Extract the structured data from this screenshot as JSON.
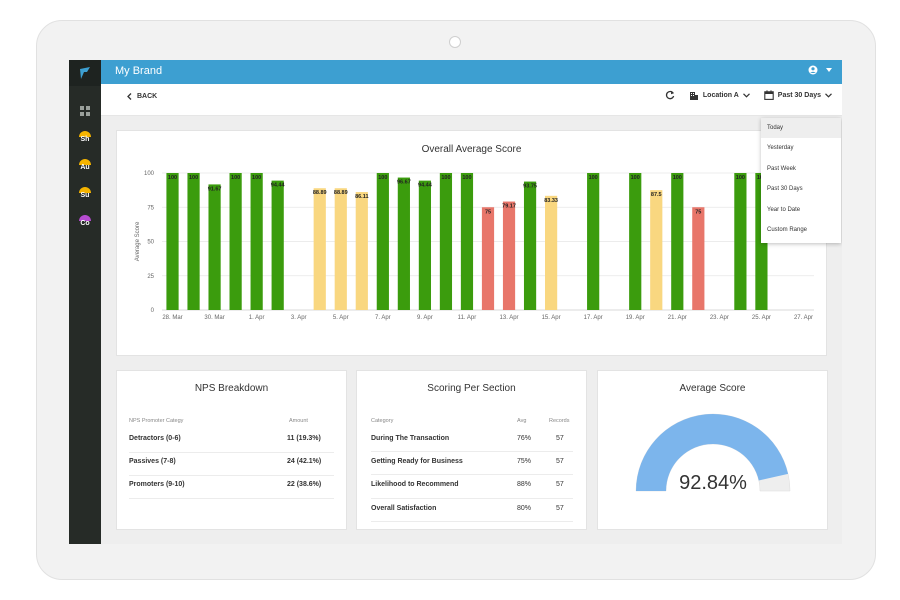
{
  "app": {
    "title": "My Brand",
    "user_icon": "account-circle-icon",
    "user_menu_icon": "caret-down-icon"
  },
  "sidebar": {
    "items": [
      {
        "label": "Sh",
        "color": "#f5b400"
      },
      {
        "label": "Au",
        "color": "#f5b400"
      },
      {
        "label": "Su",
        "color": "#f5b400"
      },
      {
        "label": "Co",
        "color": "#b54bd0"
      }
    ]
  },
  "toolbar": {
    "back_label": "BACK",
    "location_label": "Location A",
    "date_range_label": "Past 30 Days"
  },
  "date_menu": {
    "options": [
      "Today",
      "Yesterday",
      "Past Week",
      "Past 30 Days",
      "Year to Date",
      "Custom Range"
    ],
    "highlighted": "Today"
  },
  "chart_data": {
    "type": "bar",
    "title": "Overall Average Score",
    "ylabel": "Average Score",
    "xlabel": "",
    "ylim": [
      0,
      100
    ],
    "yticks": [
      0,
      25,
      50,
      75,
      100
    ],
    "grid": true,
    "x_tick_labels": [
      "28. Mar",
      "30. Mar",
      "1. Apr",
      "3. Apr",
      "5. Apr",
      "7. Apr",
      "9. Apr",
      "11. Apr",
      "13. Apr",
      "15. Apr",
      "17. Apr",
      "19. Apr",
      "21. Apr",
      "23. Apr",
      "25. Apr",
      "27. Apr"
    ],
    "bars": [
      {
        "value": 100,
        "label": "100",
        "color": "#3b9c0d"
      },
      {
        "value": 100,
        "label": "100",
        "color": "#3b9c0d"
      },
      {
        "value": 91.67,
        "label": "91.67",
        "color": "#3b9c0d"
      },
      {
        "value": 100,
        "label": "100",
        "color": "#3b9c0d"
      },
      {
        "value": 100,
        "label": "100",
        "color": "#3b9c0d"
      },
      {
        "value": 94.44,
        "label": "94.44",
        "color": "#3b9c0d"
      },
      null,
      {
        "value": 88.89,
        "label": "88.89",
        "color": "#f9d780"
      },
      {
        "value": 88.89,
        "label": "88.89",
        "color": "#f9d780"
      },
      {
        "value": 86.11,
        "label": "86.11",
        "color": "#f9d780"
      },
      {
        "value": 100,
        "label": "100",
        "color": "#3b9c0d"
      },
      {
        "value": 96.67,
        "label": "96.67",
        "color": "#3b9c0d"
      },
      {
        "value": 94.44,
        "label": "94.44",
        "color": "#3b9c0d"
      },
      {
        "value": 100,
        "label": "100",
        "color": "#3b9c0d"
      },
      {
        "value": 100,
        "label": "100",
        "color": "#3b9c0d"
      },
      {
        "value": 75,
        "label": "75",
        "color": "#e8766a"
      },
      {
        "value": 79.17,
        "label": "79.17",
        "color": "#e8766a"
      },
      {
        "value": 93.75,
        "label": "93.75",
        "color": "#3b9c0d"
      },
      {
        "value": 83.33,
        "label": "83.33",
        "color": "#f9d780"
      },
      null,
      {
        "value": 100,
        "label": "100",
        "color": "#3b9c0d"
      },
      null,
      {
        "value": 100,
        "label": "100",
        "color": "#3b9c0d"
      },
      {
        "value": 87.5,
        "label": "87.5",
        "color": "#f9d780"
      },
      {
        "value": 100,
        "label": "100",
        "color": "#3b9c0d"
      },
      {
        "value": 75,
        "label": "75",
        "color": "#e8766a"
      },
      null,
      {
        "value": 100,
        "label": "100",
        "color": "#3b9c0d"
      },
      {
        "value": 100,
        "label": "100",
        "color": "#3b9c0d"
      },
      null,
      null
    ]
  },
  "nps": {
    "title": "NPS Breakdown",
    "headers": [
      "NPS Promoter Categy",
      "Amount"
    ],
    "rows": [
      {
        "category": "Detractors (0-6)",
        "amount": "11 (19.3%)"
      },
      {
        "category": "Passives (7-8)",
        "amount": "24 (42.1%)"
      },
      {
        "category": "Promoters (9-10)",
        "amount": "22 (38.6%)"
      }
    ]
  },
  "sections": {
    "title": "Scoring Per Section",
    "headers": [
      "Category",
      "Avg",
      "Records"
    ],
    "rows": [
      {
        "category": "During The Transaction",
        "avg": "76%",
        "records": "57"
      },
      {
        "category": "Getting Ready for Business",
        "avg": "75%",
        "records": "57"
      },
      {
        "category": "Likelihood to Recommend",
        "avg": "88%",
        "records": "57"
      },
      {
        "category": "Overall Satisfaction",
        "avg": "80%",
        "records": "57"
      }
    ]
  },
  "average_score": {
    "title": "Average Score",
    "value": 92.84,
    "display": "92.84%",
    "fill_color": "#7cb5ec",
    "track_color": "#eeeeee"
  }
}
